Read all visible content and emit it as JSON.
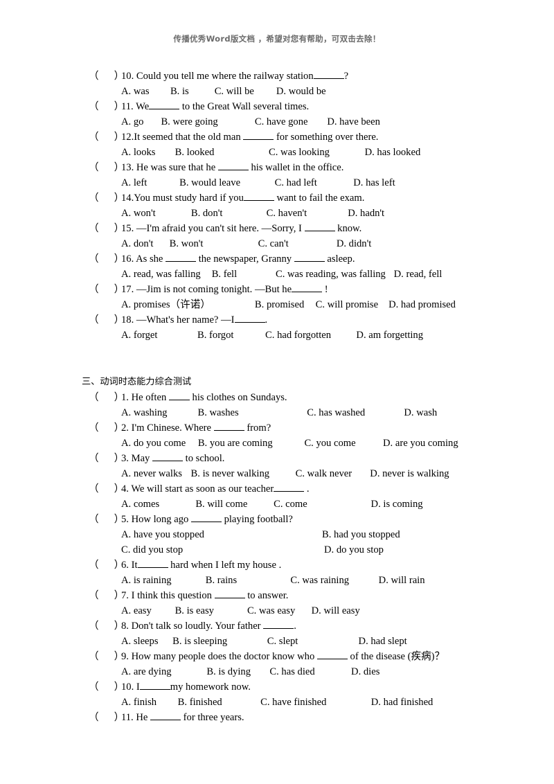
{
  "watermark": {
    "text": "传播优秀Word版文档 ，希望对您有帮助，可双击去除！",
    "color": "#6b6b6b"
  },
  "section_heading": "三、动词时态能力综合测试",
  "marker": {
    "left_paren": "（",
    "right_paren": "）"
  },
  "sections": [
    {
      "id": "section-continued",
      "questions": [
        {
          "stem_prefix": "10. Could you tell me where the railway station",
          "stem_suffix": "?",
          "blank": "md",
          "options": [
            "A. was",
            "B. is",
            "C. will be",
            "D. would be"
          ],
          "option_layout": "row",
          "option_offsets": [
            0,
            70,
            140,
            238
          ]
        },
        {
          "stem_prefix": "11. We",
          "stem_suffix": " to the Great Wall several times.",
          "blank": "md",
          "options": [
            "A. go",
            "B. were going",
            "C. have gone",
            "D. have been"
          ],
          "option_layout": "row",
          "option_offsets": [
            0,
            58,
            197,
            304
          ]
        },
        {
          "stem_prefix": "12.It seemed that the old man ",
          "stem_suffix": " for something over there.",
          "blank": "md",
          "options": [
            "A. looks",
            "B. looked",
            "C. was looking",
            "D. has looked"
          ],
          "option_layout": "row",
          "option_offsets": [
            0,
            81,
            219,
            362
          ]
        },
        {
          "stem_prefix": "13. He was sure that he ",
          "stem_suffix": " his wallet in the office.",
          "blank": "md",
          "options": [
            "A. left",
            "B. would leave",
            "C. had left",
            "D. has left"
          ],
          "option_layout": "row",
          "option_offsets": [
            0,
            93,
            235,
            360
          ]
        },
        {
          "stem_prefix": "14.You must study hard if you",
          "stem_suffix": " want to fail the exam.",
          "blank": "md",
          "options": [
            "A. won't",
            "B. don't",
            "C. haven't",
            "D. hadn't"
          ],
          "option_layout": "row",
          "option_offsets": [
            0,
            104,
            220,
            345
          ]
        },
        {
          "stem_prefix": "15. —I'm afraid you can't sit here.        —Sorry, I ",
          "stem_suffix": " know.",
          "blank": "md",
          "options": [
            "A. don't",
            "B. won't",
            "C. can't",
            "D. didn't"
          ],
          "option_layout": "row",
          "option_offsets": [
            0,
            76,
            208,
            330
          ]
        },
        {
          "stem_prefix": "16. As she ",
          "stem_mid": " the newspaper,   Granny ",
          "stem_suffix": " asleep.",
          "blank": "md",
          "blank2": "md",
          "options": [
            "A. read, was falling",
            "B. fell",
            "C. was reading, was falling",
            "D. read, fell"
          ],
          "option_layout": "row",
          "option_offsets": [
            0,
            148,
            250,
            440
          ]
        },
        {
          "stem_prefix": "17. —Jim is not coming tonight.                    —But he",
          "stem_suffix": " !",
          "blank": "md",
          "options": [
            "A. promises（许诺）",
            "B. promised",
            "C. will promise",
            "D. had promised"
          ],
          "option_layout": "row",
          "option_offsets": [
            0,
            163,
            252,
            366
          ]
        },
        {
          "stem_prefix": "18. —What's her name?               —I",
          "stem_suffix": ".",
          "blank": "md",
          "options": [
            "A. forget",
            "B. forgot",
            "C. had forgotten",
            "D. am forgetting"
          ],
          "option_layout": "row",
          "option_offsets": [
            0,
            117,
            222,
            364
          ]
        }
      ]
    },
    {
      "id": "section-three",
      "questions": [
        {
          "stem_prefix": "1. He often ",
          "stem_suffix": " his clothes on Sundays.",
          "blank": "sm",
          "options": [
            "A. washing",
            "B. washes",
            "C. has washed",
            "D. wash"
          ],
          "option_layout": "row",
          "option_offsets": [
            0,
            110,
            268,
            410
          ]
        },
        {
          "stem_prefix": "2. I'm Chinese. Where ",
          "stem_suffix": " from?",
          "blank": "md",
          "options": [
            "A. do you come",
            "B. you are coming",
            "C. you come",
            "D. are you coming"
          ],
          "option_layout": "row",
          "option_offsets": [
            0,
            110,
            268,
            380
          ]
        },
        {
          "stem_prefix": "3. May ",
          "stem_suffix": " to school.",
          "blank": "md",
          "options": [
            "A. never walks",
            "B. is never walking",
            "C. walk never",
            "D. never is walking"
          ],
          "option_layout": "row",
          "option_offsets": [
            0,
            105,
            268,
            380
          ]
        },
        {
          "stem_prefix": "4. We will start as soon as our teacher",
          "stem_suffix": " .",
          "blank": "md",
          "options": [
            "A. comes",
            "B. will come",
            "C. come",
            "D. is coming"
          ],
          "option_layout": "row",
          "option_offsets": [
            0,
            105,
            222,
            360
          ]
        },
        {
          "stem_prefix": "5. How long ago ",
          "stem_suffix": " playing football?",
          "blank": "md",
          "options": [
            "A. have you stopped",
            "B. had you stopped",
            "C. did you stop",
            "D. do you stop"
          ],
          "option_layout": "grid",
          "option_offsets": [
            0,
            290,
            0,
            293
          ]
        },
        {
          "stem_prefix": "6. It",
          "stem_suffix": " hard when I left my house .",
          "blank": "md",
          "options": [
            "A. is raining",
            "B. rains",
            "C. was raining",
            "D. will rain"
          ],
          "option_layout": "row",
          "option_offsets": [
            0,
            135,
            265,
            400
          ]
        },
        {
          "stem_prefix": "7. I think this question ",
          "stem_suffix": " to answer.",
          "blank": "md",
          "options": [
            "A. easy",
            "B. is easy",
            "C. was easy",
            "D. will easy"
          ],
          "option_layout": "row",
          "option_offsets": [
            0,
            80,
            194,
            290
          ]
        },
        {
          "stem_prefix": "8. Don't talk so loudly. Your father ",
          "stem_suffix": ".",
          "blank": "md",
          "options": [
            "A. sleeps",
            "B. is sleeping",
            "C. slept",
            "D. had slept"
          ],
          "option_layout": "row",
          "option_offsets": [
            0,
            80,
            230,
            370
          ]
        },
        {
          "stem_prefix": "9. How many people does the doctor know who ",
          "stem_suffix": " of the disease (疾病)？",
          "blank": "md",
          "options": [
            "A. are dying",
            "B. is dying",
            "C. has died",
            "D. dies"
          ],
          "option_layout": "row",
          "option_offsets": [
            0,
            130,
            230,
            355
          ]
        },
        {
          "stem_prefix": "10. I",
          "stem_suffix": "my homework now.",
          "blank": "md",
          "options": [
            "A. finish",
            "B. finished",
            "C. have finished",
            "D. had finished"
          ],
          "option_layout": "row",
          "option_offsets": [
            0,
            90,
            218,
            388
          ]
        },
        {
          "stem_prefix": "11. He ",
          "stem_suffix": " for three years.",
          "blank": "md",
          "options": [],
          "option_layout": "none",
          "option_offsets": []
        }
      ]
    }
  ]
}
